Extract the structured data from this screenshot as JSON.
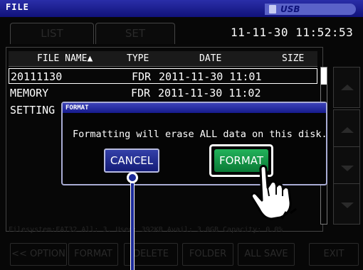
{
  "window": {
    "title": "FILE"
  },
  "storage": {
    "label": "USB"
  },
  "tabs": {
    "list": "LIST",
    "set": "SET"
  },
  "datetime": "11-11-30 11:52:53",
  "file_list": {
    "columns": {
      "name": "FILE NAME▲",
      "type": "TYPE",
      "date": "DATE",
      "size": "SIZE"
    },
    "rows": [
      {
        "name": "20111130",
        "type": "FDR",
        "date": "2011-11-30 11:01"
      },
      {
        "name": "MEMORY",
        "type": "FDR",
        "date": "2011-11-30 11:02"
      },
      {
        "name": "SETTING",
        "type": "",
        "date": ""
      }
    ]
  },
  "status_line": "Filesystem:FAT32 All: 3.  Used: 392KB Avail: 3.0GB Capacity: 0.0%",
  "dialog": {
    "title": "FORMAT",
    "message": "Formatting will erase ALL data on this disk.",
    "cancel_label": "CANCEL",
    "format_label": "FORMAT"
  },
  "bottom_buttons": {
    "option": "<< OPTION",
    "format": "FORMAT",
    "delete": "DELETE",
    "folder": "FOLDER",
    "all_save": "ALL SAVE",
    "exit": "EXIT"
  },
  "colors": {
    "titlebar": "#1a1e9a",
    "cancel_button": "#1f2a90",
    "format_button": "#12984a",
    "callout": "#1c2a9a"
  }
}
